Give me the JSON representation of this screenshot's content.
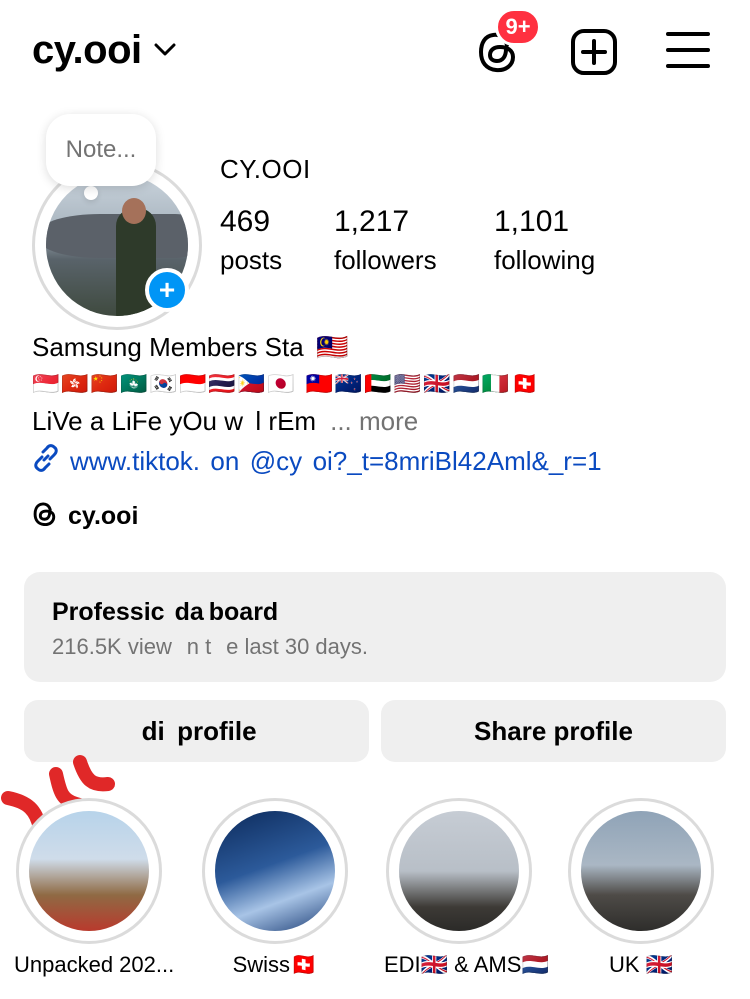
{
  "header": {
    "username": "cy.ooi",
    "notification_badge": "9+"
  },
  "profile": {
    "note_placeholder": "Note...",
    "display_name": "CY.OOI",
    "stats": [
      {
        "value": "469",
        "label": "posts"
      },
      {
        "value": "1,217",
        "label": "followers"
      },
      {
        "value": "1,101",
        "label": "following"
      }
    ],
    "bio_line1": "Samsung Members Sta  🇲🇾",
    "bio_flags": "🇸🇬🇭🇰🇨🇳🇲🇴🇰🇷🇮🇩🇹🇭🇵🇭🇯🇵  🇹🇼🇳🇿🇦🇪🇺🇸🇬🇧🇳🇱🇮🇹🇨🇭",
    "bio_line3": "LiVe a LiFe yOu w  l rEm",
    "more_label": "... more",
    "link_text": "www.tiktok.  on  @cy  oi?_t=8mriBl42Aml&_r=1",
    "threads_handle": "cy.ooi"
  },
  "dashboard": {
    "title": "Professic  da board",
    "subtitle": "216.5K view   n t   e last 30 days."
  },
  "buttons": {
    "edit_profile": " di  profile",
    "share_profile": "Share profile"
  },
  "highlights": [
    {
      "label": "Unpacked 202...",
      "flag": ""
    },
    {
      "label": "Swiss",
      "flag": "🇨🇭"
    },
    {
      "label": "EDI🇬🇧 & AMS",
      "flag": "🇳🇱"
    },
    {
      "label": "UK ",
      "flag": "🇬🇧"
    }
  ],
  "colors": {
    "badge": "#ff3040",
    "link": "#0a4ac0",
    "accent_blue": "#0095f6",
    "button_bg": "#efefef",
    "muted_text": "#737373"
  }
}
